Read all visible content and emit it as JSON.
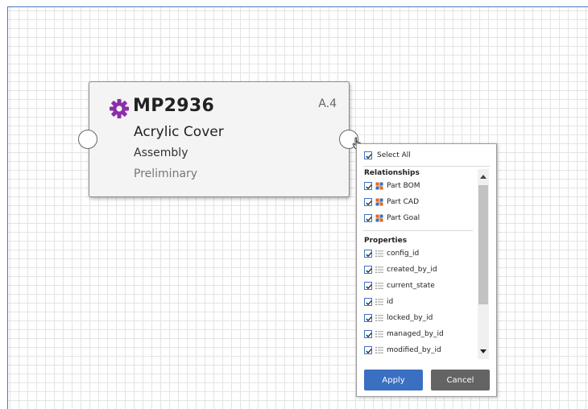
{
  "node": {
    "icon": "gear-icon",
    "icon_color": "#8a2fa8",
    "title": "MP2936",
    "revision": "A.4",
    "name": "Acrylic Cover",
    "type": "Assembly",
    "state": "Preliminary"
  },
  "popup": {
    "select_all_label": "Select All",
    "relationships_header": "Relationships",
    "relationships": [
      {
        "label": "Part BOM",
        "checked": true
      },
      {
        "label": "Part CAD",
        "checked": true
      },
      {
        "label": "Part Goal",
        "checked": true
      }
    ],
    "properties_header": "Properties",
    "properties": [
      {
        "label": "config_id",
        "checked": true
      },
      {
        "label": "created_by_id",
        "checked": true
      },
      {
        "label": "current_state",
        "checked": true
      },
      {
        "label": "id",
        "checked": true
      },
      {
        "label": "locked_by_id",
        "checked": true
      },
      {
        "label": "managed_by_id",
        "checked": true
      },
      {
        "label": "modified_by_id",
        "checked": true
      }
    ],
    "apply_label": "Apply",
    "cancel_label": "Cancel"
  },
  "colors": {
    "accent": "#3a6fc2",
    "cancel": "#646464",
    "checkbox": "#3a75c4"
  }
}
